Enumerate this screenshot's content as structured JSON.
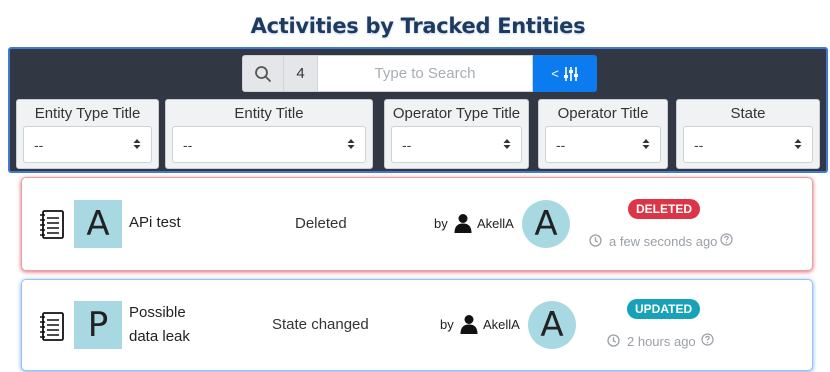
{
  "page": {
    "title": "Activities by Tracked Entities"
  },
  "search": {
    "count": "4",
    "placeholder": "Type to Search",
    "toggle_label": "<"
  },
  "filters": [
    {
      "label": "Entity Type Title",
      "value": "--"
    },
    {
      "label": "Entity Title",
      "value": "--"
    },
    {
      "label": "Operator Type Title",
      "value": "--"
    },
    {
      "label": "Operator Title",
      "value": "--"
    },
    {
      "label": "State",
      "value": "--"
    }
  ],
  "activities": [
    {
      "letter": "A",
      "title_line1": "APi test",
      "title_line2": "",
      "action": "Deleted",
      "by": "by",
      "operator": "AkellA",
      "operator_initial": "A",
      "status": "DELETED",
      "status_color": "#dc3545",
      "time": "a few seconds ago"
    },
    {
      "letter": "P",
      "title_line1": "Possible",
      "title_line2": "data leak",
      "action": "State changed",
      "by": "by",
      "operator": "AkellA",
      "operator_initial": "A",
      "status": "UPDATED",
      "status_color": "#17a2b8",
      "time": "2 hours ago"
    }
  ],
  "colors": {
    "panel_bg": "#313843",
    "panel_border": "#3f7ad6",
    "accent": "#0d7bf0",
    "avatar_bg": "#a8d8e2"
  },
  "icons": [
    "search-icon",
    "sliders-icon",
    "caret-updown-icon",
    "notebook-icon",
    "user-icon",
    "clock-icon",
    "help-icon"
  ]
}
